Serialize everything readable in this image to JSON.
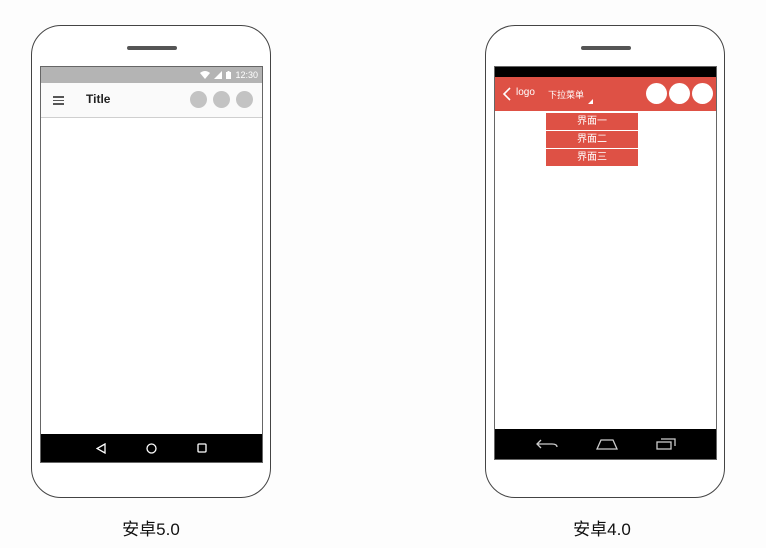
{
  "android5": {
    "status_time": "12:30",
    "app_title": "Title",
    "caption": "安卓5.0"
  },
  "android4": {
    "logo_label": "logo",
    "dropdown_label": "下拉菜单",
    "menu_items": [
      "界面一",
      "界面二",
      "界面三"
    ],
    "caption": "安卓4.0"
  },
  "colors": {
    "android4_accent": "#de5145",
    "android5_placeholder": "#c3c3c3",
    "statusbar_grey": "#b4b4b4"
  }
}
